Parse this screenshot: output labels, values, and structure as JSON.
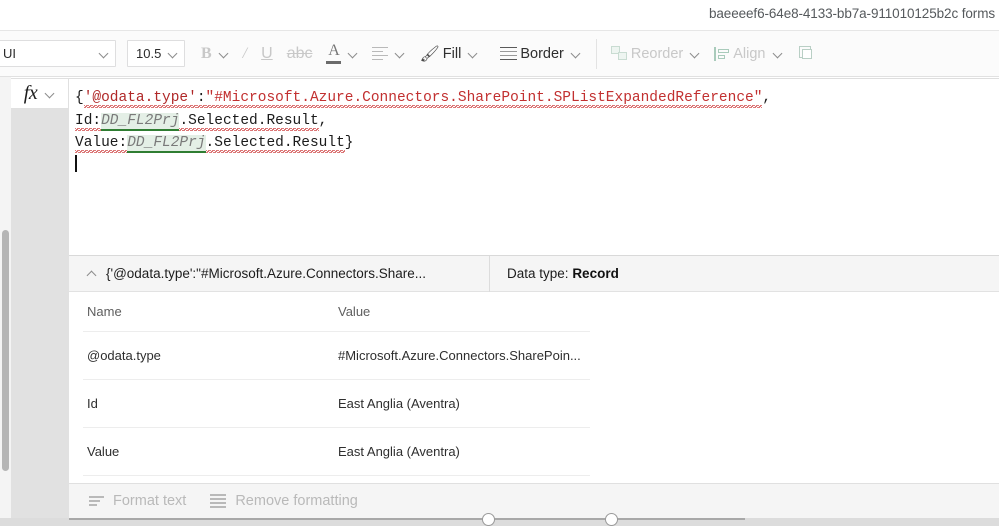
{
  "titlebar": {
    "text": "baeeeef6-64e8-4133-bb7a-911010125b2c forms"
  },
  "toolbar": {
    "font_name": "UI",
    "font_size": "10.5",
    "bold_label": "B",
    "italic_label": "/",
    "underline_label": "U",
    "strikethrough_label": "abc",
    "font_color_label": "A",
    "fill_label": "Fill",
    "border_label": "Border",
    "reorder_label": "Reorder",
    "align_label": "Align"
  },
  "formula_bar": {
    "fx_label": "fx",
    "line1": {
      "open_brace": "{",
      "property": "'@odata.type'",
      "colon": ":",
      "string": "\"#Microsoft.Azure.Connectors.SharePoint.SPListExpandedReference\"",
      "comma": ","
    },
    "line2": {
      "name": "Id:",
      "reference": "DD_FL2Prj",
      "suffix": ".Selected.Result",
      "comma": ","
    },
    "line3": {
      "name": "Value:",
      "reference": "DD_FL2Prj",
      "suffix": ".Selected.Result",
      "close_brace": "}"
    },
    "full_text": "{'@odata.type':\"#Microsoft.Azure.Connectors.SharePoint.SPListExpandedReference\", Id:DD_FL2Prj.Selected.Result, Value:DD_FL2Prj.Selected.Result}"
  },
  "result_panel": {
    "collapse_icon": "chevron-up",
    "title": "{'@odata.type':\"#Microsoft.Azure.Connectors.Share...",
    "data_type_label": "Data type:",
    "data_type_value": "Record",
    "table": {
      "columns": [
        "Name",
        "Value"
      ],
      "rows": [
        {
          "name": "@odata.type",
          "value": "#Microsoft.Azure.Connectors.SharePoin..."
        },
        {
          "name": "Id",
          "value": "East Anglia (Aventra)"
        },
        {
          "name": "Value",
          "value": "East Anglia (Aventra)"
        }
      ]
    }
  },
  "bottom_bar": {
    "format_text_label": "Format text",
    "remove_formatting_label": "Remove formatting"
  },
  "colors": {
    "formula_keyword": "#b02828",
    "formula_string": "#c23030",
    "reference_highlight": "#e4efe6",
    "reference_underline": "#2f7d32",
    "error_squiggle": "#d04a4a",
    "panel_header_bg": "#f5f5f5",
    "toolbar_bg": "#fbfbfb",
    "disabled_text": "#c8c8c8"
  }
}
